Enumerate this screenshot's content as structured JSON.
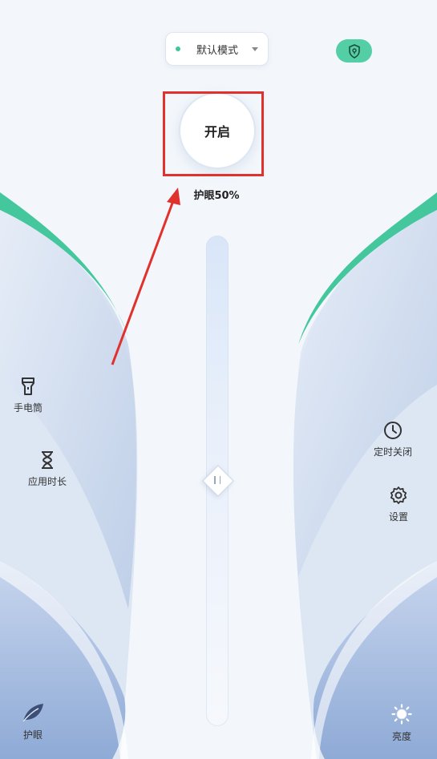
{
  "mode_selector": {
    "label": "默认模式"
  },
  "power_button": {
    "label": "开启"
  },
  "eye_protection": {
    "level_text": "护眼50%",
    "level": 0.5
  },
  "left_tools": [
    {
      "label": "手电筒",
      "icon": "flashlight-icon"
    },
    {
      "label": "应用时长",
      "icon": "hourglass-icon"
    }
  ],
  "right_tools": [
    {
      "label": "定时关闭",
      "icon": "clock-icon"
    },
    {
      "label": "设置",
      "icon": "gear-icon"
    }
  ],
  "bottom_nav": {
    "left": {
      "label": "护眼",
      "icon": "leaf-icon"
    },
    "right": {
      "label": "亮度",
      "icon": "sun-icon"
    }
  },
  "colors": {
    "accent": "#54cfa5",
    "highlight": "#e0312d"
  }
}
